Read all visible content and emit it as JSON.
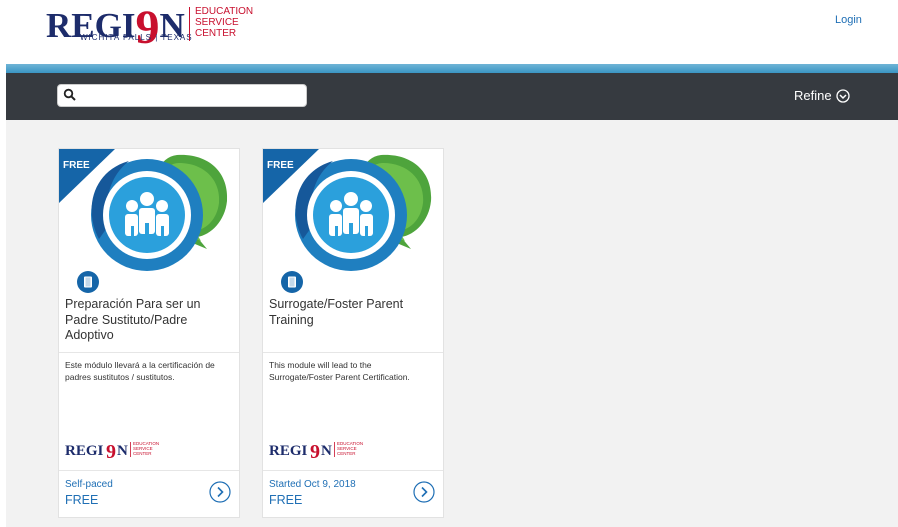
{
  "header": {
    "logo": {
      "brand_left": "REGI",
      "brand_nine": "9",
      "brand_right": "N",
      "sub": "WICHITA FALLS | TEXAS",
      "esc": "EDUCATION SERVICE CENTER"
    },
    "login_label": "Login"
  },
  "toolbar": {
    "search_placeholder": "",
    "refine_label": "Refine"
  },
  "colors": {
    "brand_navy": "#1d2c6b",
    "brand_red": "#c8102e",
    "link_blue": "#1f6fb5",
    "toolbar_bg": "#363a40",
    "stripe": "#3a95c4"
  },
  "cards": [
    {
      "badge": "FREE",
      "title": "Preparación Para ser un Padre Sustituto/Padre Adoptivo",
      "description": "Este módulo llevará a la certificación de padres sustitutos / sustitutos.",
      "meta": "Self-paced",
      "price": "FREE",
      "icon": "people-group-icon",
      "type_icon": "book-icon"
    },
    {
      "badge": "FREE",
      "title": "Surrogate/Foster Parent Training",
      "description": "This module will lead to the Surrogate/Foster Parent Certification.",
      "meta": "Started Oct 9, 2018",
      "price": "FREE",
      "icon": "people-group-icon",
      "type_icon": "book-icon"
    }
  ]
}
